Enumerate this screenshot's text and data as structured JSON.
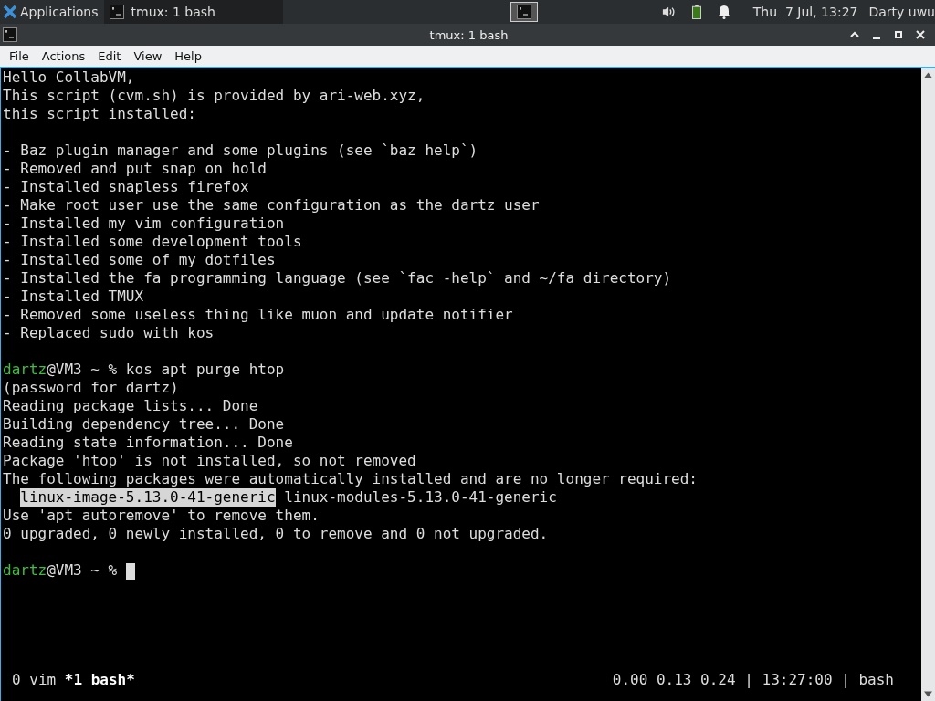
{
  "panel": {
    "menu_label": "Applications",
    "tasks": [
      {
        "label": "tmux: 1 bash",
        "selected": true
      }
    ],
    "clock": "Thu  7 Jul, 13:27",
    "user": "Darty uwu"
  },
  "window": {
    "title": "tmux: 1 bash"
  },
  "menu": [
    "File",
    "Actions",
    "Edit",
    "View",
    "Help"
  ],
  "terminal": {
    "lines": [
      {
        "kind": "output",
        "text": "Hello CollabVM,"
      },
      {
        "kind": "output",
        "text": "This script (cvm.sh) is provided by ari-web.xyz,"
      },
      {
        "kind": "output",
        "text": "this script installed:"
      },
      {
        "kind": "blank"
      },
      {
        "kind": "output",
        "text": "- Baz plugin manager and some plugins (see `baz help`)"
      },
      {
        "kind": "output",
        "text": "- Removed and put snap on hold"
      },
      {
        "kind": "output",
        "text": "- Installed snapless firefox"
      },
      {
        "kind": "output",
        "text": "- Make root user use the same configuration as the dartz user"
      },
      {
        "kind": "output",
        "text": "- Installed my vim configuration"
      },
      {
        "kind": "output",
        "text": "- Installed some development tools"
      },
      {
        "kind": "output",
        "text": "- Installed some of my dotfiles"
      },
      {
        "kind": "output",
        "text": "- Installed the fa programming language (see `fac -help` and ~/fa directory)"
      },
      {
        "kind": "output",
        "text": "- Installed TMUX"
      },
      {
        "kind": "output",
        "text": "- Removed some useless thing like muon and update notifier"
      },
      {
        "kind": "output",
        "text": "- Replaced sudo with kos"
      },
      {
        "kind": "blank"
      },
      {
        "kind": "prompt",
        "user": "dartz",
        "host": "@VM3 ~ %",
        "command": "kos apt purge htop"
      },
      {
        "kind": "output",
        "text": "(password for dartz)"
      },
      {
        "kind": "output",
        "text": "Reading package lists... Done"
      },
      {
        "kind": "output",
        "text": "Building dependency tree... Done"
      },
      {
        "kind": "output",
        "text": "Reading state information... Done"
      },
      {
        "kind": "output",
        "text": "Package 'htop' is not installed, so not removed"
      },
      {
        "kind": "output",
        "text": "The following packages were automatically installed and are no longer required:"
      },
      {
        "kind": "packages",
        "items": [
          {
            "text": "linux-image-5.13.0-41-generic",
            "selected": true
          },
          {
            "text": "linux-modules-5.13.0-41-generic",
            "selected": false
          }
        ]
      },
      {
        "kind": "output",
        "text": "Use 'apt autoremove' to remove them."
      },
      {
        "kind": "output",
        "text": "0 upgraded, 0 newly installed, 0 to remove and 0 not upgraded."
      },
      {
        "kind": "blank"
      },
      {
        "kind": "prompt",
        "user": "dartz",
        "host": "@VM3 ~ %",
        "cursor": true
      }
    ]
  },
  "status_bar": {
    "windows": [
      {
        "label": "0 vim",
        "selected": false
      },
      {
        "label": "*1 bash*",
        "selected": true
      }
    ],
    "right": "0.00 0.13 0.24 | 13:27:00 | bash"
  }
}
